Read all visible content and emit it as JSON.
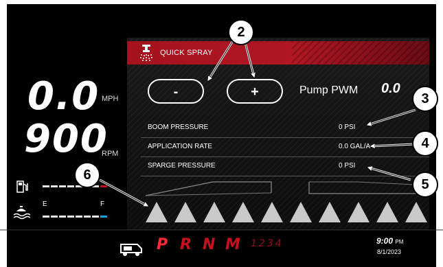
{
  "speed": {
    "value": "0.0",
    "unit": "MPH"
  },
  "rpm": {
    "value": "900",
    "unit": "RPM"
  },
  "quick_spray": {
    "title": "QUICK SPRAY",
    "minus_label": "-",
    "plus_label": "+",
    "pump_label": "Pump PWM",
    "pump_value": "0.0"
  },
  "readings": [
    {
      "label": "BOOM PRESSURE",
      "value": "0 PSI"
    },
    {
      "label": "APPLICATION RATE",
      "value": "0.0 GAL/A"
    },
    {
      "label": "SPARGE PRESSURE",
      "value": "0 PSI"
    }
  ],
  "gauges": {
    "fuel": {
      "level": 0.9,
      "color": "#c0101e"
    },
    "water": {
      "empty_label": "E",
      "full_label": "F",
      "level": 0.9,
      "color": "#1a9de0"
    }
  },
  "gears": {
    "letters": [
      "P",
      "R",
      "N",
      "M"
    ],
    "numbers": "1234",
    "active": "P"
  },
  "clock": {
    "time": "9:00",
    "ampm": "PM",
    "date": "8/1/2023"
  },
  "callouts": [
    "2",
    "3",
    "4",
    "6",
    "5"
  ],
  "icons": [
    "fuel-icon",
    "water-tank-icon",
    "spray-nozzle-icon",
    "vehicle-icon"
  ]
}
